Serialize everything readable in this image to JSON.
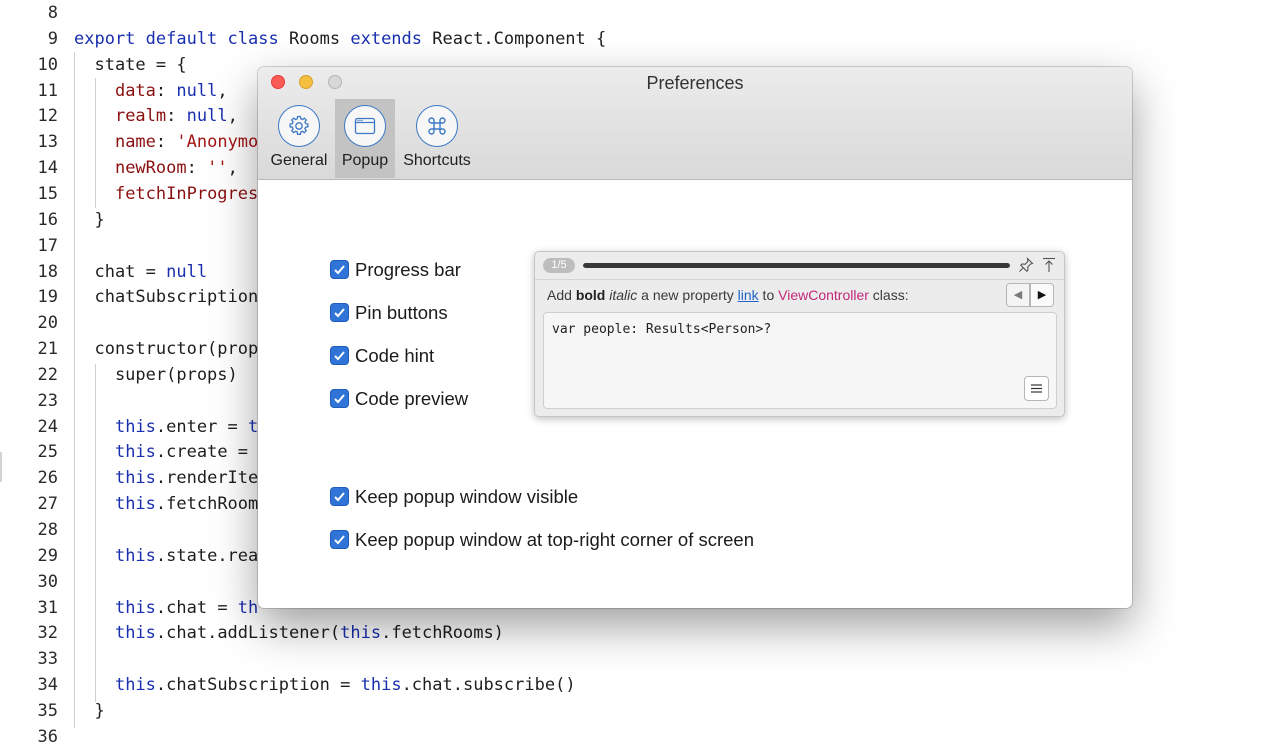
{
  "editor": {
    "lines": [
      {
        "n": "8",
        "html": ""
      },
      {
        "n": "9",
        "html": "<span class=\"kw\">export default class</span> Rooms <span class=\"kw\">extends</span> React.Component {"
      },
      {
        "n": "10",
        "html": "  state = {"
      },
      {
        "n": "11",
        "html": "    <span class=\"prop\">data</span>: <span class=\"kw\">null</span>,"
      },
      {
        "n": "12",
        "html": "    <span class=\"prop\">realm</span>: <span class=\"kw\">null</span>,"
      },
      {
        "n": "13",
        "html": "    <span class=\"prop\">name</span>: <span class=\"str\">'Anonymo</span>"
      },
      {
        "n": "14",
        "html": "    <span class=\"prop\">newRoom</span>: <span class=\"str\">''</span>,"
      },
      {
        "n": "15",
        "html": "    <span class=\"prop\">fetchInProgres</span>"
      },
      {
        "n": "16",
        "html": "  }"
      },
      {
        "n": "17",
        "html": ""
      },
      {
        "n": "18",
        "html": "  chat = <span class=\"kw\">null</span>"
      },
      {
        "n": "19",
        "html": "  chatSubscription"
      },
      {
        "n": "20",
        "html": ""
      },
      {
        "n": "21",
        "html": "  constructor(prop"
      },
      {
        "n": "22",
        "html": "    super(props)"
      },
      {
        "n": "23",
        "html": ""
      },
      {
        "n": "24",
        "html": "    <span class=\"kw\">this</span>.enter = <span class=\"kw\">t</span>"
      },
      {
        "n": "25",
        "html": "    <span class=\"kw\">this</span>.create = "
      },
      {
        "n": "26",
        "html": "    <span class=\"kw\">this</span>.renderIte"
      },
      {
        "n": "27",
        "html": "    <span class=\"kw\">this</span>.fetchRoom"
      },
      {
        "n": "28",
        "html": ""
      },
      {
        "n": "29",
        "html": "    <span class=\"kw\">this</span>.state.rea"
      },
      {
        "n": "30",
        "html": ""
      },
      {
        "n": "31",
        "html": "    <span class=\"kw\">this</span>.chat = <span class=\"kw\">th</span>"
      },
      {
        "n": "32",
        "html": "    <span class=\"kw\">this</span>.chat.addListener(<span class=\"kw\">this</span>.fetchRooms)"
      },
      {
        "n": "33",
        "html": ""
      },
      {
        "n": "34",
        "html": "    <span class=\"kw\">this</span>.chatSubscription = <span class=\"kw\">this</span>.chat.subscribe()"
      },
      {
        "n": "35",
        "html": "  }"
      },
      {
        "n": "36",
        "html": ""
      }
    ]
  },
  "window": {
    "title": "Preferences"
  },
  "tabs": [
    {
      "id": "general",
      "label": "General",
      "icon": "gear-icon",
      "active": false
    },
    {
      "id": "popup",
      "label": "Popup",
      "icon": "window-icon",
      "active": true
    },
    {
      "id": "shortcuts",
      "label": "Shortcuts",
      "icon": "command-icon",
      "active": false
    }
  ],
  "options": {
    "progress_bar": {
      "label": "Progress bar",
      "checked": true
    },
    "pin_buttons": {
      "label": "Pin buttons",
      "checked": true
    },
    "code_hint": {
      "label": "Code hint",
      "checked": true
    },
    "code_preview": {
      "label": "Code preview",
      "checked": true
    },
    "keep_visible": {
      "label": "Keep popup window visible",
      "checked": true
    },
    "keep_top_right": {
      "label": "Keep popup window at top-right corner of screen",
      "checked": true
    }
  },
  "preview": {
    "counter": "1/5",
    "progress_fraction": 1.0,
    "hint": {
      "prefix": "Add ",
      "bold": "bold",
      "italic": "italic",
      "middle": " a new property ",
      "link": "link",
      "to": " to ",
      "class_name": "ViewController",
      "suffix": " class:"
    },
    "code_sample": "var people: Results<Person>?",
    "nav_prev": "◀",
    "nav_next": "▶"
  },
  "colors": {
    "accent": "#2f74d6",
    "keyword": "#1a2fb0",
    "string": "#a31515",
    "link": "#1f64c9",
    "class_name": "#c2287a"
  }
}
